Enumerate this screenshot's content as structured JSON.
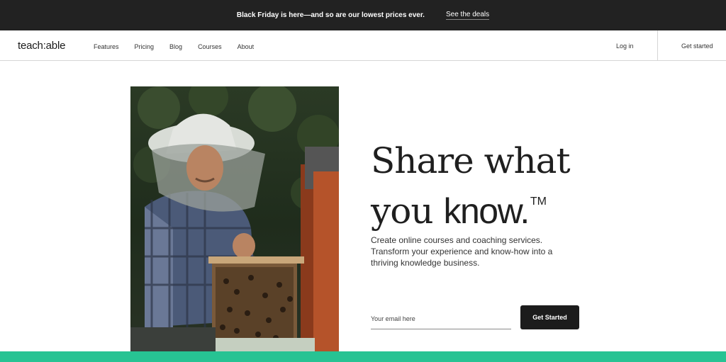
{
  "promo": {
    "text": "Black Friday is here—and so are our lowest prices ever.",
    "link": "See the deals"
  },
  "nav": {
    "logo": "teach:able",
    "links": [
      "Features",
      "Pricing",
      "Blog",
      "Courses",
      "About"
    ],
    "login": "Log in",
    "get_started": "Get started"
  },
  "hero": {
    "headline_part1": "Share what",
    "headline_part2": "you ",
    "headline_emphasis": "know.",
    "trademark": "TM",
    "subtext": "Create online courses and coaching services. Transform your experience and know-how into a thriving knowledge business.",
    "email_placeholder": "Your email here",
    "cta_label": "Get Started"
  },
  "colors": {
    "promo_bg": "#222222",
    "accent_green": "#27c393",
    "cta_bg": "#1c1c1c"
  }
}
